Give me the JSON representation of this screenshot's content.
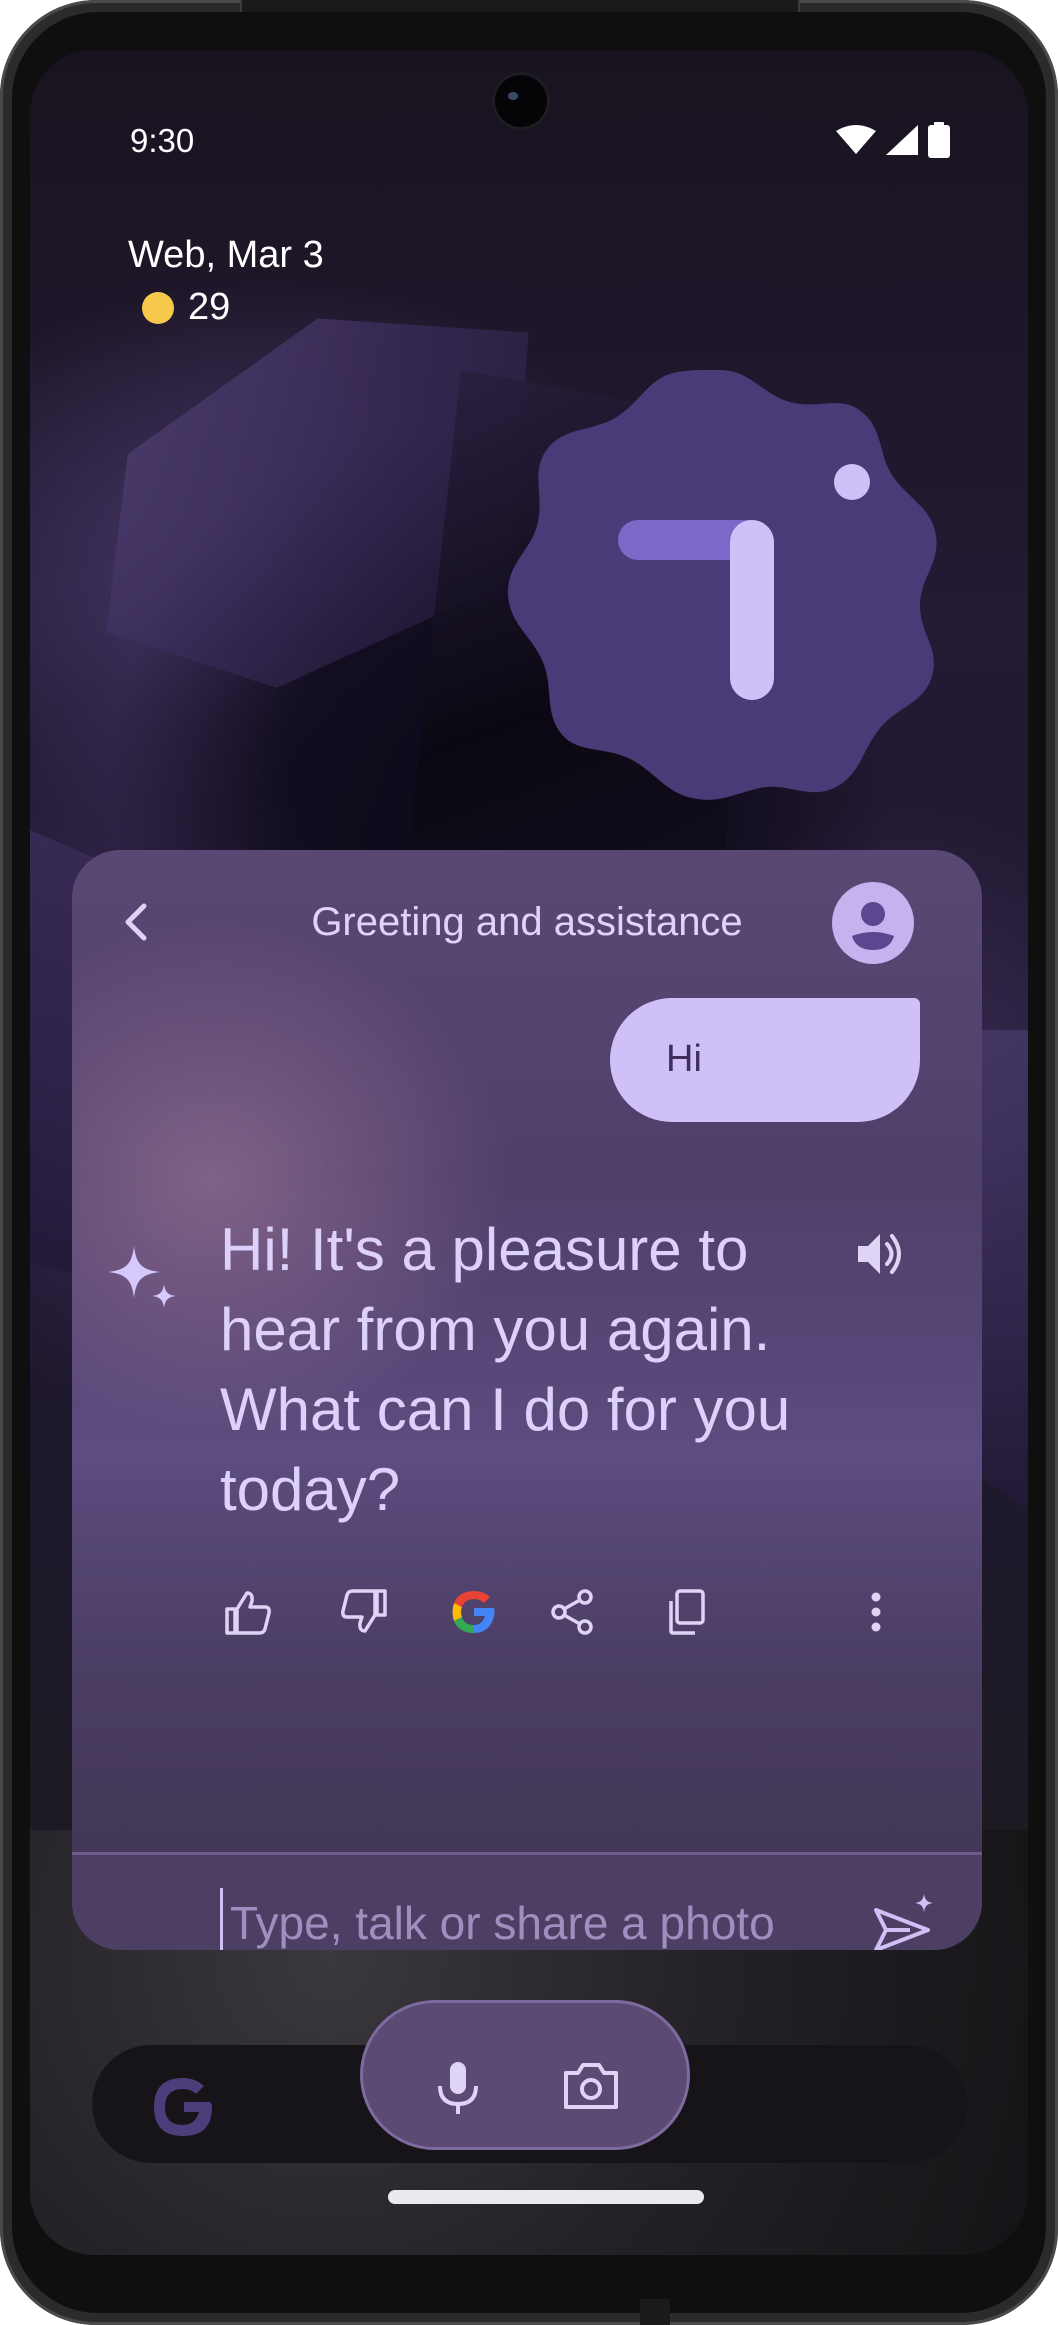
{
  "status_bar": {
    "time": "9:30",
    "icons": [
      "wifi-icon",
      "signal-icon",
      "battery-icon"
    ]
  },
  "at_a_glance": {
    "date": "Web, Mar 3",
    "temperature": "29",
    "weather_icon": "sun-icon"
  },
  "clock_widget": {
    "type": "analog-clock"
  },
  "assistant": {
    "title": "Greeting and assistance",
    "user_message": "Hi",
    "reply": "Hi! It's a pleasure to hear from you again. What can I do for you today?",
    "actions": [
      "thumbs-up-icon",
      "thumbs-down-icon",
      "google-icon",
      "share-icon",
      "copy-icon",
      "more-icon"
    ],
    "input_placeholder": "Type, talk or share a photo"
  },
  "search_bar": {
    "logo": "google-logo-icon",
    "buttons": [
      "mic-icon",
      "camera-icon"
    ]
  },
  "colors": {
    "accent": "#cfc1f8",
    "card": "#5a4874",
    "clock_face": "#4a3a78",
    "weather_sun": "#f6c94c"
  }
}
